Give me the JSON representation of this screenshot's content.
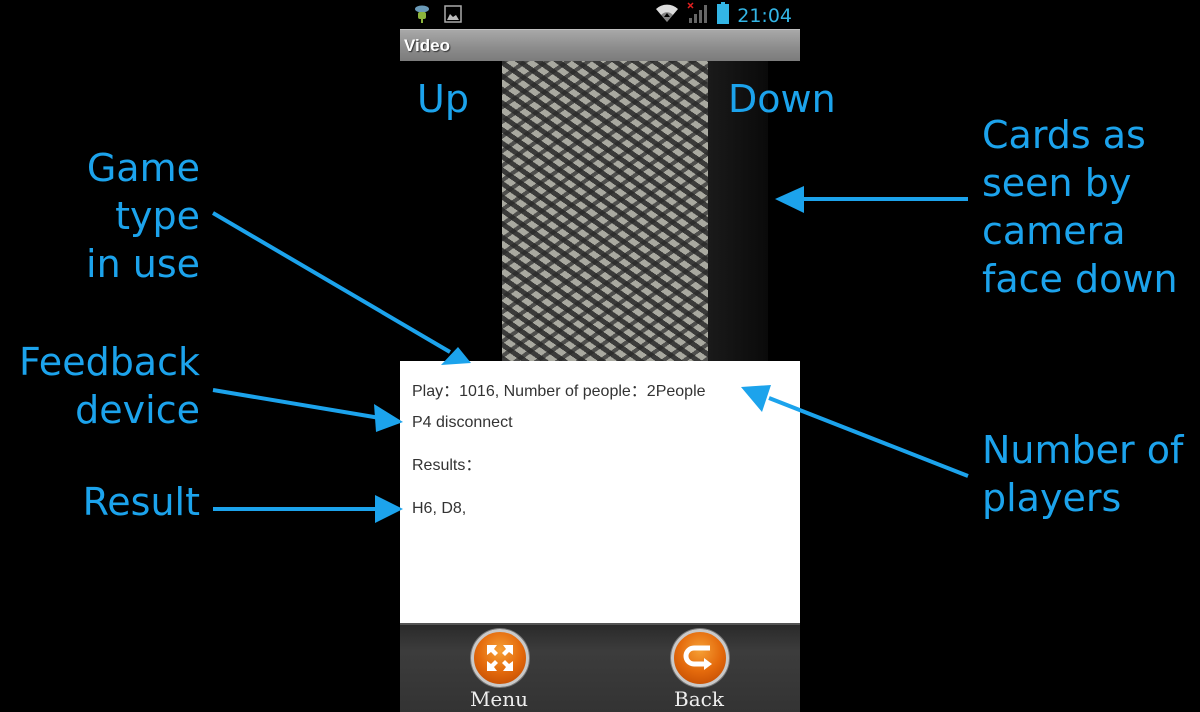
{
  "status_bar": {
    "time": "21:04",
    "icons": [
      "usb-debug-icon",
      "image-notification-icon",
      "wifi-icon",
      "signal-no-service-icon",
      "battery-icon"
    ]
  },
  "app": {
    "title": "Video"
  },
  "video": {
    "up_label": "Up",
    "down_label": "Down"
  },
  "info": {
    "play_line": "Play：1016, Number of people：2People",
    "feedback_line": "P4 disconnect",
    "results_label": "Results：",
    "results_value": "H6, D8,"
  },
  "bottom_bar": {
    "menu_label": "Menu",
    "back_label": "Back"
  },
  "annotations": {
    "game_type": [
      "Game",
      "type",
      "in use"
    ],
    "feedback_device": [
      "Feedback",
      "device"
    ],
    "result": "Result",
    "cards": [
      "Cards as",
      "seen by",
      "camera",
      "face down"
    ],
    "number_of_players": [
      "Number of",
      "players"
    ]
  },
  "colors": {
    "annotation": "#1ca3ec",
    "clock": "#33b5e5",
    "button_orange": "#e46a0c"
  }
}
